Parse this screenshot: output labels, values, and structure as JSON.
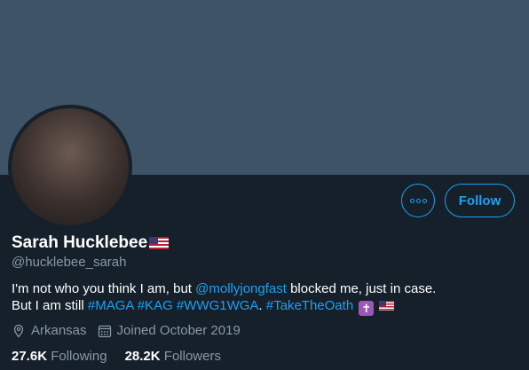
{
  "profile": {
    "name": "Sarah Hucklebee",
    "handle": "@hucklebee_sarah",
    "bio_line1_prefix": "I'm not who you think I am, but ",
    "bio_mention": "@mollyjongfast",
    "bio_line1_suffix": " blocked me, just in case.",
    "bio_line2_prefix": "But I am still ",
    "bio_tags": [
      "#MAGA",
      "#KAG",
      "#WWG1WGA",
      "#TakeTheOath"
    ],
    "bio_line2_dot": ".",
    "location": "Arkansas",
    "joined": "Joined October 2019"
  },
  "actions": {
    "follow_label": "Follow"
  },
  "stats": {
    "following_count": "27.6K",
    "following_label": "Following",
    "followers_count": "28.2K",
    "followers_label": "Followers"
  },
  "icons": {
    "more": "more-icon",
    "location": "location-pin-icon",
    "calendar": "calendar-icon"
  },
  "colors": {
    "background": "#15202b",
    "banner": "#3f5366",
    "accent": "#1da1f2",
    "secondary_text": "#8899a6"
  }
}
